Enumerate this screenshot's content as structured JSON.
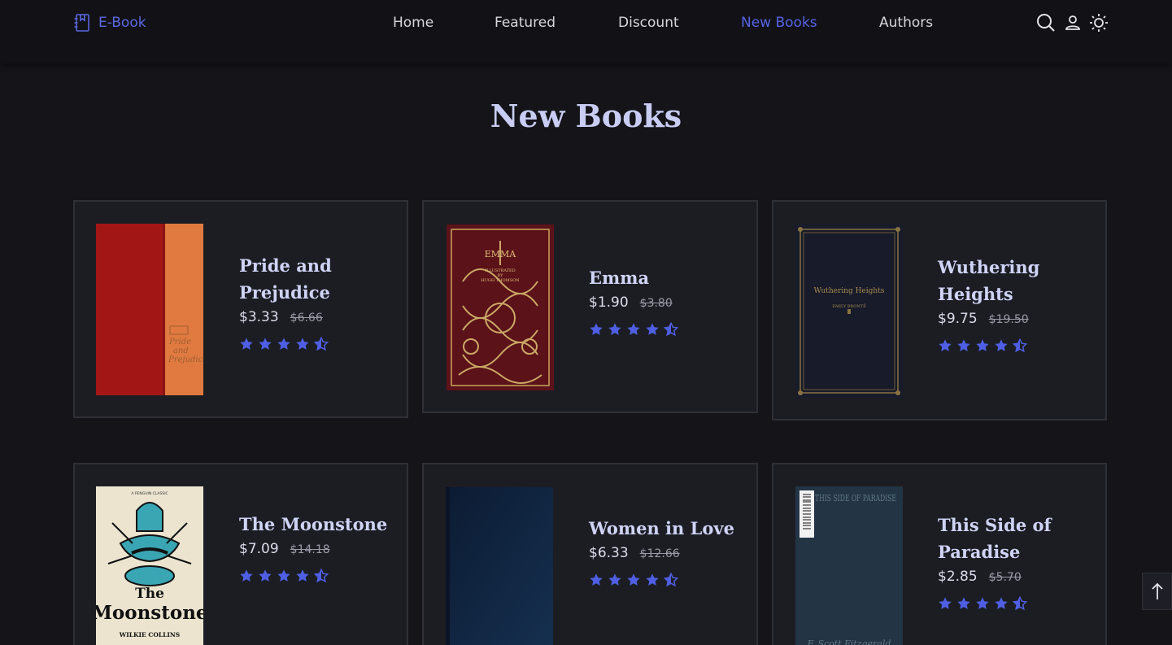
{
  "header": {
    "logo_text": "E-Book",
    "nav": [
      {
        "label": "Home",
        "active": false
      },
      {
        "label": "Featured",
        "active": false
      },
      {
        "label": "Discount",
        "active": false
      },
      {
        "label": "New Books",
        "active": true
      },
      {
        "label": "Authors",
        "active": false
      }
    ],
    "icons": [
      "search-icon",
      "user-icon",
      "sun-icon"
    ]
  },
  "section": {
    "title": "New Books"
  },
  "books": [
    {
      "title": "Pride and Prejudice",
      "price": "$3.33",
      "old_price": "$6.66",
      "rating": 4.5
    },
    {
      "title": "Emma",
      "price": "$1.90",
      "old_price": "$3.80",
      "rating": 4.5
    },
    {
      "title": "Wuthering Heights",
      "price": "$9.75",
      "old_price": "$19.50",
      "rating": 4.5
    },
    {
      "title": "The Moonstone",
      "price": "$7.09",
      "old_price": "$14.18",
      "rating": 4.5
    },
    {
      "title": "Women in Love",
      "price": "$6.33",
      "old_price": "$12.66",
      "rating": 4.5
    },
    {
      "title": "This Side of Paradise",
      "price": "$2.85",
      "old_price": "$5.70",
      "rating": 4.5
    }
  ],
  "cover_text": {
    "pride": {
      "line1": "Pride",
      "line2": "and",
      "line3": "Prejudice"
    },
    "emma": {
      "title": "EMMA",
      "line1": "ILLUSTRATED",
      "line2": "BY",
      "line3": "HUGH THOMSON"
    },
    "wuthering": {
      "title": "Wuthering Heights",
      "author": "EMILY BRONTË"
    },
    "moonstone": {
      "publisher": "A PENGUIN CLASSIC",
      "line1": "The",
      "line2": "Moonstone",
      "author": "WILKIE COLLINS"
    },
    "paradise": {
      "title": "THIS SIDE OF PARADISE",
      "author": "F. Scott Fitzgerald"
    }
  },
  "colors": {
    "accent": "#5563e6",
    "star": "#4f5fe3",
    "background": "#141419",
    "card": "#1c1d23"
  },
  "scroll_top_icon": "arrow-up-icon"
}
